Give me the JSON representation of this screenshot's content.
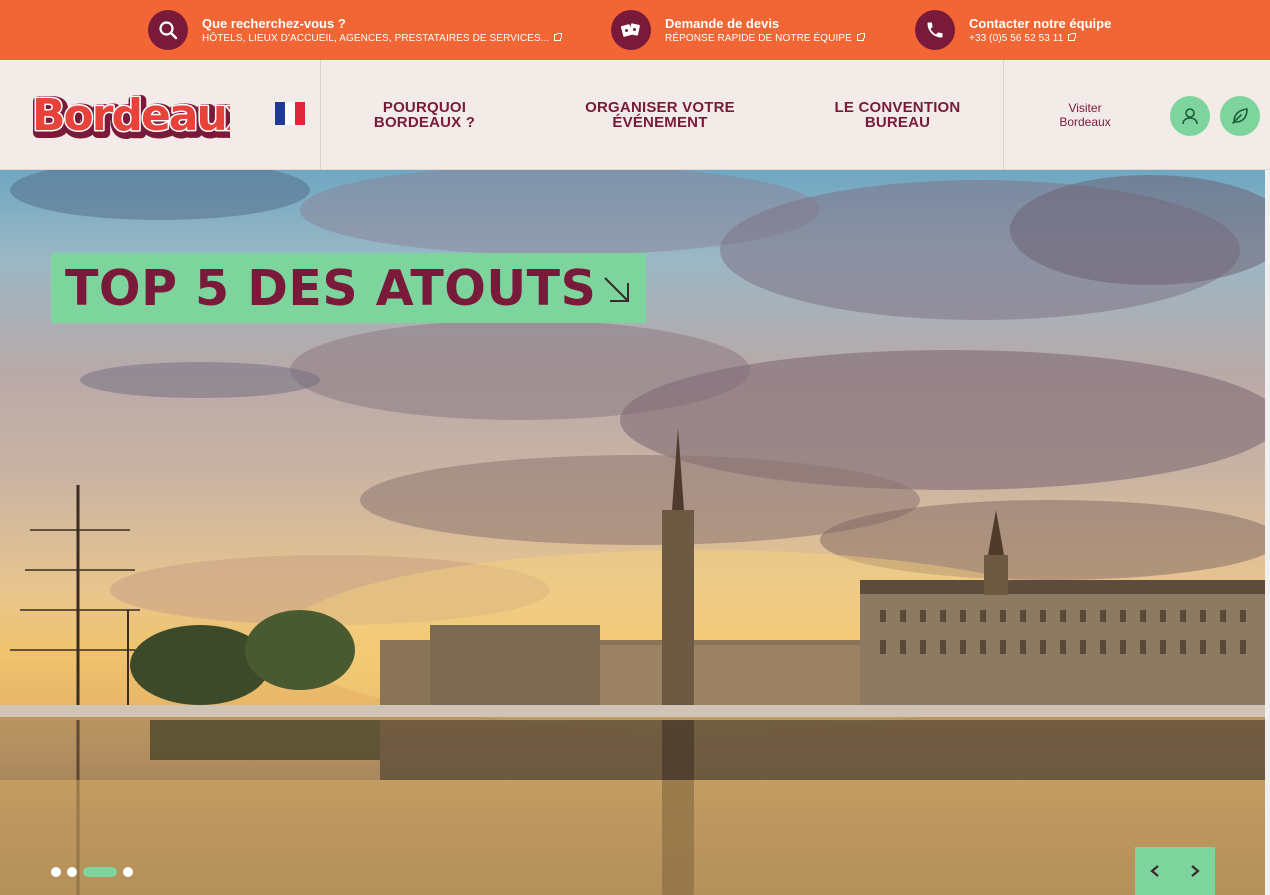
{
  "topbar": {
    "search": {
      "title": "Que recherchez-vous ?",
      "subtitle": "HÔTELS, LIEUX D'ACCUEIL, AGENCES, PRESTATAIRES DE SERVICES..."
    },
    "quote": {
      "title": "Demande de devis",
      "subtitle": "RÉPONSE RAPIDE DE NOTRE ÉQUIPE"
    },
    "contact": {
      "title": "Contacter notre équipe",
      "subtitle": "+33 (0)5 56 52 53 11"
    },
    "bg_color": "#f26535",
    "circle_color": "#7a1a3a"
  },
  "header": {
    "logo_text": "Bordeaux",
    "language": "FR",
    "nav": [
      {
        "line1": "POURQUOI",
        "line2": "BORDEAUX ?"
      },
      {
        "line1": "ORGANISER VOTRE",
        "line2": "ÉVÉNEMENT"
      },
      {
        "line1": "LE CONVENTION",
        "line2": "BUREAU"
      }
    ],
    "visit_line1": "Visiter",
    "visit_line2": "Bordeaux",
    "account_icon": "user-icon",
    "eco_icon": "leaf-icon",
    "brand_color": "#7a1a3a",
    "accent_color": "#7dd49d"
  },
  "hero": {
    "headline": "TOP 5 DES ATOUTS",
    "slides": 4,
    "active_slide": 3,
    "prev_icon": "chevron-left-icon",
    "next_icon": "chevron-right-icon"
  }
}
